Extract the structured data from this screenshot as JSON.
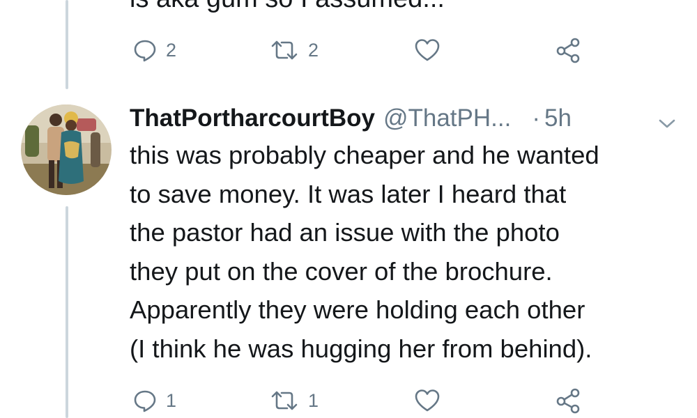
{
  "previous_tweet": {
    "text_fragment": "is aka gum so I assumed...",
    "reply_count": "2",
    "retweet_count": "2"
  },
  "tweet": {
    "display_name": "ThatPortharcourtBoy",
    "handle": "@ThatPH...",
    "separator": "·",
    "time": "5h",
    "lines": [
      "this was probably cheaper and he wanted",
      "to save money. It was later I heard that",
      "the pastor had an issue with the photo",
      "they put on the cover of the brochure.",
      "Apparently they were holding each other",
      "(I think he was hugging her from behind)."
    ],
    "reply_count": "1",
    "retweet_count": "1"
  },
  "icons": {
    "reply": "reply-icon",
    "retweet": "retweet-icon",
    "like": "heart-icon",
    "share": "share-icon",
    "menu": "chevron-down-icon"
  },
  "colors": {
    "text": "#14171a",
    "secondary": "#657786",
    "thread_line": "#ccd6dd"
  }
}
